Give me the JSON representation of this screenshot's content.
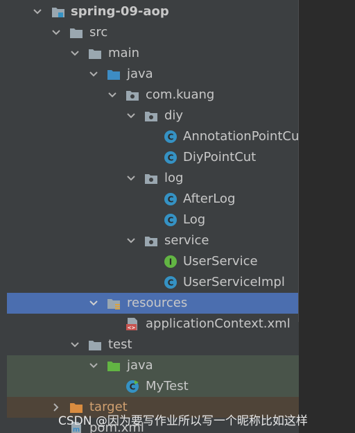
{
  "tree": [
    {
      "label": "spring-09-aop",
      "bold": true
    },
    {
      "label": "src"
    },
    {
      "label": "main"
    },
    {
      "label": "java"
    },
    {
      "label": "com.kuang"
    },
    {
      "label": "diy"
    },
    {
      "label": "AnnotationPointCut"
    },
    {
      "label": "DiyPointCut"
    },
    {
      "label": "log"
    },
    {
      "label": "AfterLog"
    },
    {
      "label": "Log"
    },
    {
      "label": "service"
    },
    {
      "label": "UserService"
    },
    {
      "label": "UserServiceImpl"
    },
    {
      "label": "resources"
    },
    {
      "label": "applicationContext.xml"
    },
    {
      "label": "test"
    },
    {
      "label": "java"
    },
    {
      "label": "MyTest"
    },
    {
      "label": "target"
    },
    {
      "label": "pom.xml"
    }
  ],
  "colors": {
    "selected": "#4b6eaf",
    "class_icon": "#3592c4",
    "interface_icon": "#62b543",
    "folder_gray": "#9aa7b0",
    "folder_blue": "#3d8cc4",
    "folder_green": "#62b543",
    "folder_orange": "#d98c40"
  },
  "watermark": "CSDN @因为要写作业所以写一个昵称比如这样"
}
